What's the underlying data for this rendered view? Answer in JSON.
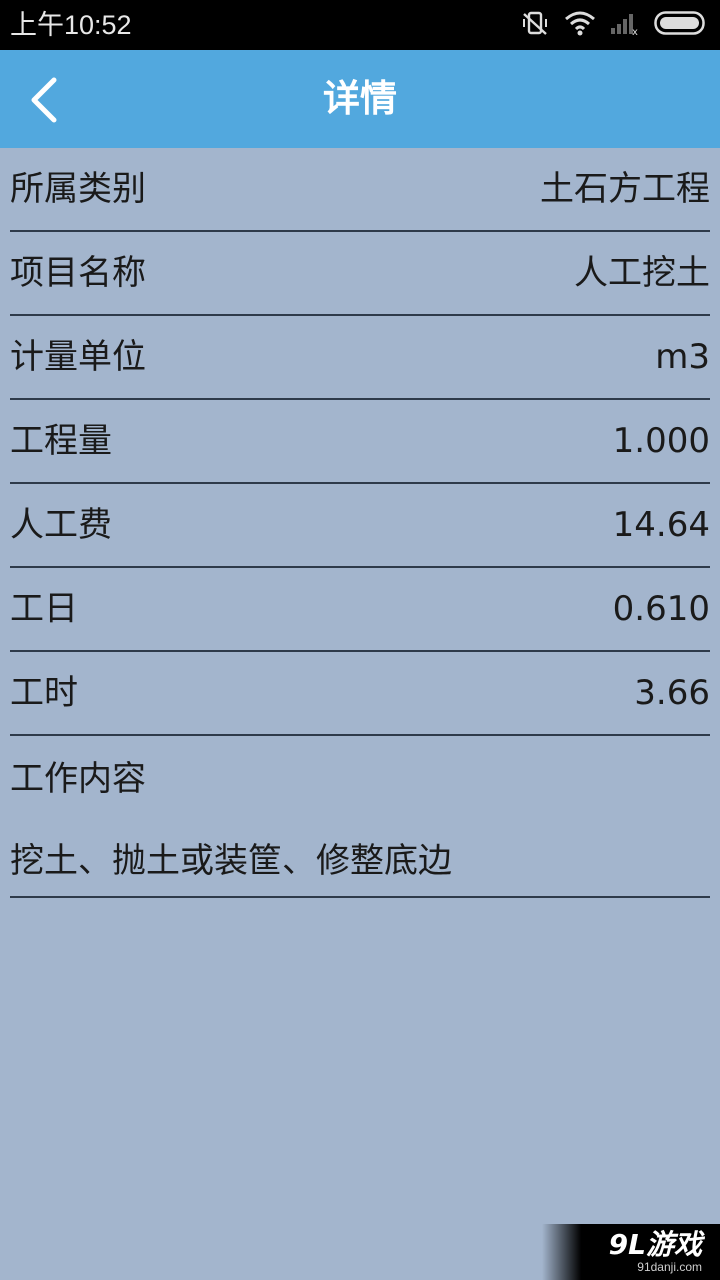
{
  "status_bar": {
    "time": "上午10:52",
    "icons": [
      "vibrate-off-icon",
      "wifi-icon",
      "signal-icon",
      "battery-icon"
    ]
  },
  "header": {
    "title": "详情",
    "back_icon": "chevron-left-icon",
    "background": "#52a8de"
  },
  "details": [
    {
      "label": "所属类别",
      "value": "土石方工程"
    },
    {
      "label": "项目名称",
      "value": "人工挖土"
    },
    {
      "label": "计量单位",
      "value": "m3"
    },
    {
      "label": "工程量",
      "value": "1.000"
    },
    {
      "label": "人工费",
      "value": "14.64"
    },
    {
      "label": "工日",
      "value": "0.610"
    },
    {
      "label": "工时",
      "value": "3.66"
    }
  ],
  "work_content": {
    "label": "工作内容",
    "text": "挖土、抛土或装筐、修整底边"
  },
  "watermark": {
    "logo": "9L游戏",
    "url": "91danji.com"
  },
  "colors": {
    "page_background": "#a3b5cd",
    "divider": "#2e3a4a"
  }
}
